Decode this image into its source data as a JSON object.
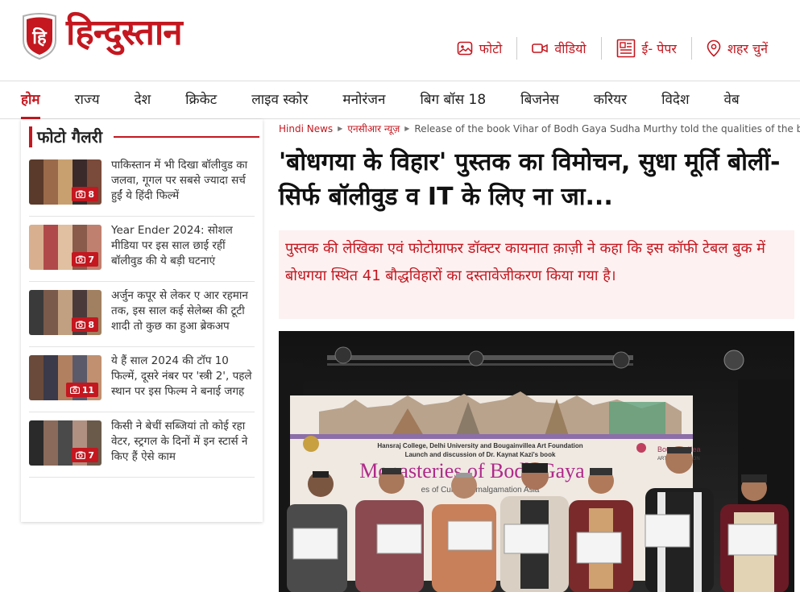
{
  "header": {
    "logo_letter": "हि",
    "logo_text": "हिन्दुस्तान",
    "links": [
      {
        "label": "फोटो",
        "icon": "photo-icon"
      },
      {
        "label": "वीडियो",
        "icon": "video-icon"
      },
      {
        "label": "ई- पेपर",
        "icon": "epaper-icon"
      },
      {
        "label": "शहर चुनें",
        "icon": "location-pin-icon"
      }
    ]
  },
  "nav": {
    "items": [
      "होम",
      "राज्य",
      "देश",
      "क्रिकेट",
      "लाइव स्कोर",
      "मनोरंजन",
      "बिग बॉस 18",
      "बिजनेस",
      "करियर",
      "विदेश",
      "वेब"
    ]
  },
  "gallery": {
    "title": "फोटो गैलरी",
    "items": [
      {
        "text": "पाकिस्तान में भी दिखा बॉलीवुड का जलवा, गूगल पर सबसे ज्यादा सर्च हुईं ये हिंदी फिल्में",
        "count": "8"
      },
      {
        "text": "Year Ender 2024: सोशल मीडिया पर इस साल छाई रहीं बॉलीवुड की ये बड़ी घटनाएं",
        "count": "7"
      },
      {
        "text": "अर्जुन कपूर से लेकर ए आर रहमान तक, इस साल कई सेलेब्स की टूटी शादी तो कुछ का हुआ ब्रेकअप",
        "count": "8"
      },
      {
        "text": "ये हैं साल 2024 की टॉप 10 फिल्में, दूसरे नंबर पर 'स्त्री 2', पहले स्थान पर इस फिल्म ने बनाई जगह",
        "count": "11"
      },
      {
        "text": "किसी ने बेचीं सब्जियां तो कोई रहा वेटर, स्ट्रगल के दिनों में इन स्टार्स ने किए हैं ऐसे काम",
        "count": "7"
      }
    ]
  },
  "breadcrumb": {
    "home": "Hindi News",
    "section": "एनसीआर न्यूज़",
    "current": "Release of the book Vihar of Bodh Gaya Sudha Murthy told the qualities of the book"
  },
  "article": {
    "headline": "'बोधगया के विहार' पुस्तक का विमोचन, सुधा मूर्ति बोलीं- सिर्फ बॉलीवुड व IT के लिए ना जा...",
    "summary": "पुस्तक की लेखिका एवं फोटोग्राफर डॉक्टर कायनात क़ाज़ी ने कहा कि इस कॉफी टेबल बुक में बोधगया स्थित 41 बौद्धविहारों का दस्तावेजीकरण किया गया है।"
  },
  "photo": {
    "banner_line1": "Hansraj College, Delhi University and Bougainvillea Art Foundation",
    "banner_line2": "Launch and discussion of Dr. Kaynat Kazi's book",
    "banner_title": "Monasteries of Bodh Gaya",
    "banner_sub": "es of Cultural Amalgamation Asia",
    "logo_text": "Bougainvillea",
    "logo_sub": "ART FOUNDATION"
  },
  "colors": {
    "brand": "#c4171f",
    "summary_bg": "#fdf1f1"
  }
}
